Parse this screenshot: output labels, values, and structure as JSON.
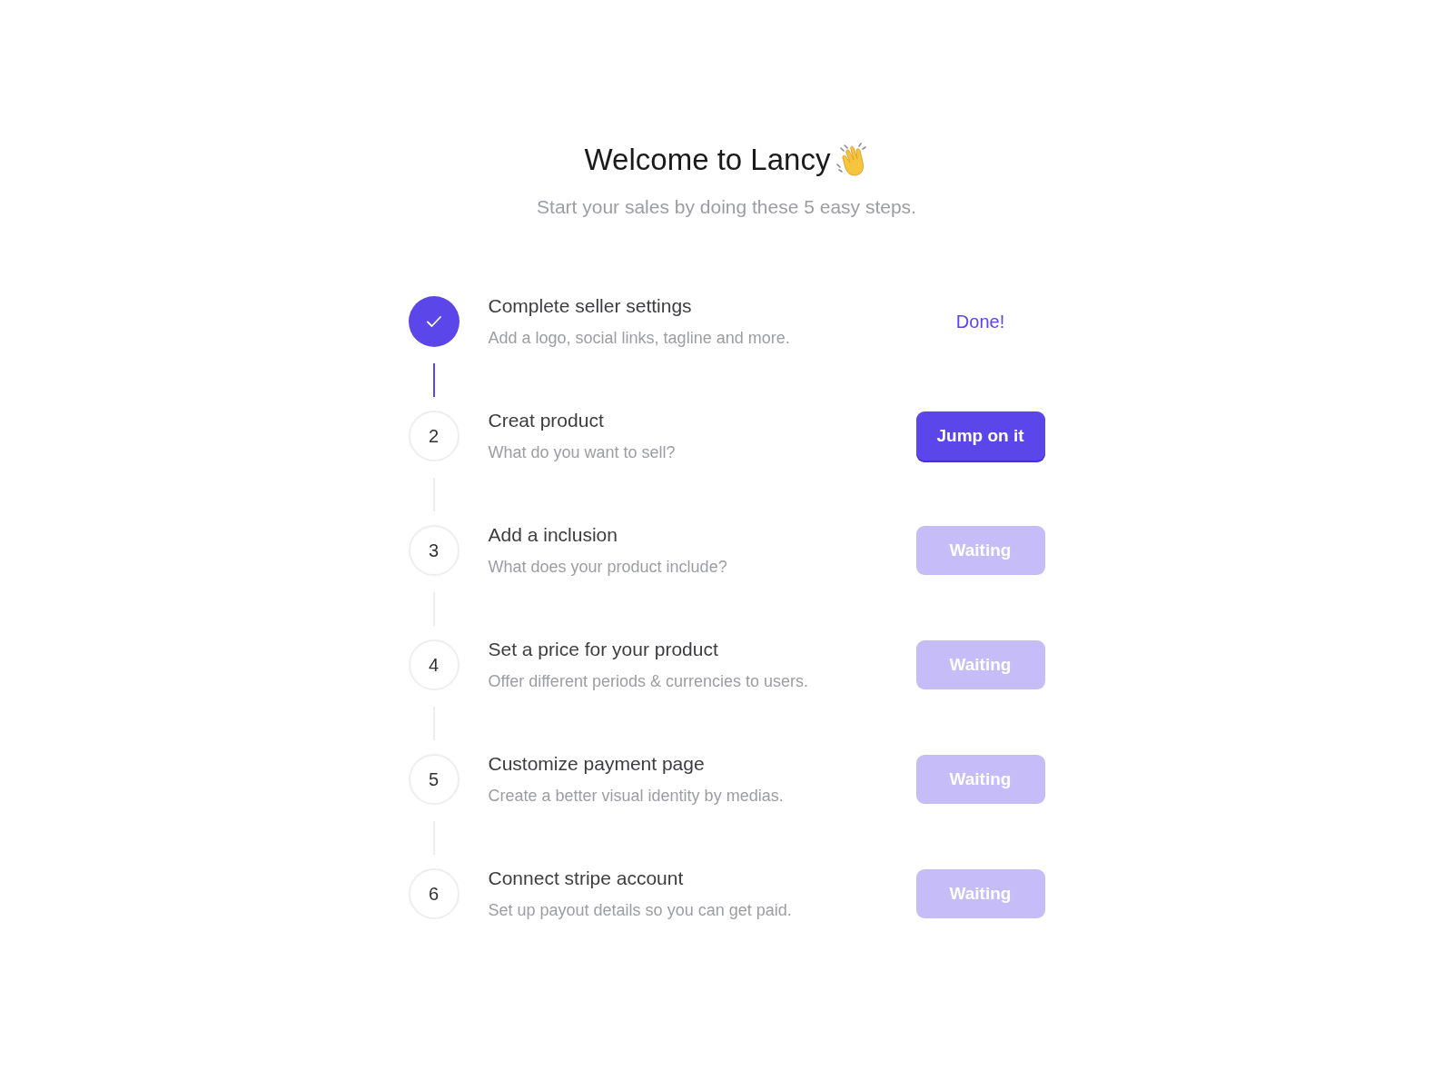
{
  "header": {
    "title": "Welcome to Lancy",
    "subtitle": "Start your sales by doing these 5 easy steps."
  },
  "steps": [
    {
      "kind": "done",
      "title": "Complete seller settings",
      "description": "Add a logo, social links, tagline and more.",
      "action": "Done!"
    },
    {
      "kind": "active",
      "number": "2",
      "title": "Creat product",
      "description": "What do you want to sell?",
      "action": "Jump on it"
    },
    {
      "kind": "waiting",
      "number": "3",
      "title": "Add a inclusion",
      "description": "What does your product include?",
      "action": "Waiting"
    },
    {
      "kind": "waiting",
      "number": "4",
      "title": "Set a price for your product",
      "description": "Offer different periods & currencies to users.",
      "action": "Waiting"
    },
    {
      "kind": "waiting",
      "number": "5",
      "title": "Customize payment page",
      "description": "Create a better visual identity by medias.",
      "action": "Waiting"
    },
    {
      "kind": "waiting",
      "number": "6",
      "title": "Connect stripe account",
      "description": "Set up payout details so you can get paid.",
      "action": "Waiting"
    }
  ]
}
